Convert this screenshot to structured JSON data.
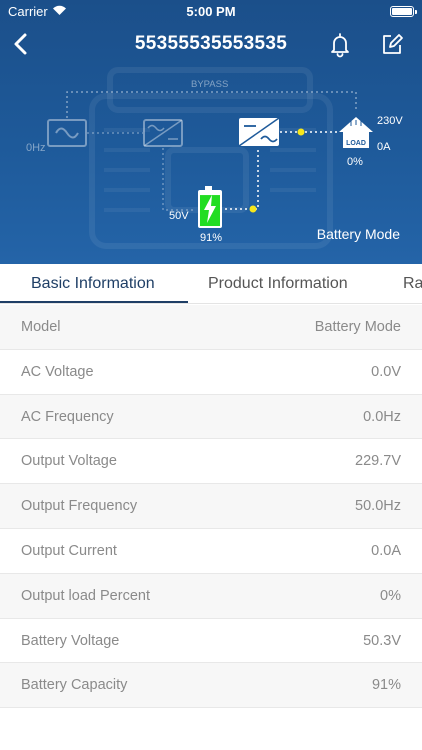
{
  "status": {
    "carrier": "Carrier",
    "time": "5:00 PM"
  },
  "header": {
    "title": "55355535553535"
  },
  "flow": {
    "bypass": "BYPASS",
    "input_freq": "0Hz",
    "output_voltage": "230V",
    "output_current": "0A",
    "load_percent": "0%",
    "load_text": "LOAD",
    "battery_voltage": "50V",
    "battery_percent": "91%",
    "battery_level": 0.91,
    "mode": "Battery Mode"
  },
  "tabs": [
    {
      "label": "Basic Information",
      "active": true
    },
    {
      "label": "Product Information",
      "active": false
    },
    {
      "label": "Ra",
      "active": false
    }
  ],
  "rows": [
    {
      "label": "Model",
      "value": "Battery Mode"
    },
    {
      "label": "AC Voltage",
      "value": "0.0V"
    },
    {
      "label": "AC Frequency",
      "value": "0.0Hz"
    },
    {
      "label": "Output Voltage",
      "value": "229.7V"
    },
    {
      "label": "Output Frequency",
      "value": "50.0Hz"
    },
    {
      "label": "Output Current",
      "value": "0.0A"
    },
    {
      "label": "Output load Percent",
      "value": "0%"
    },
    {
      "label": "Battery Voltage",
      "value": "50.3V"
    },
    {
      "label": "Battery Capacity",
      "value": "91%"
    }
  ],
  "colors": {
    "header": "#1e5a9a",
    "accent": "#1f3f66",
    "battery": "#22dd22",
    "dot": "#f5e61b"
  },
  "icons": [
    "wifi-icon",
    "back-icon",
    "bell-icon",
    "edit-icon",
    "ac-input-icon",
    "rectifier-icon",
    "inverter-icon",
    "home-load-icon",
    "battery-charging-icon"
  ]
}
